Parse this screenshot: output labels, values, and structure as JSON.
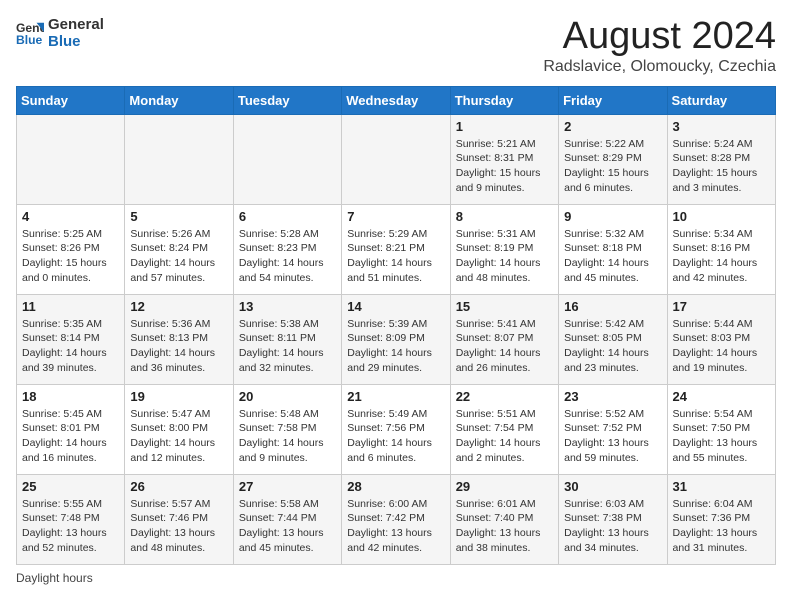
{
  "header": {
    "logo_line1": "General",
    "logo_line2": "Blue",
    "title": "August 2024",
    "subtitle": "Radslavice, Olomoucky, Czechia"
  },
  "days_of_week": [
    "Sunday",
    "Monday",
    "Tuesday",
    "Wednesday",
    "Thursday",
    "Friday",
    "Saturday"
  ],
  "weeks": [
    [
      {
        "num": "",
        "info": ""
      },
      {
        "num": "",
        "info": ""
      },
      {
        "num": "",
        "info": ""
      },
      {
        "num": "",
        "info": ""
      },
      {
        "num": "1",
        "info": "Sunrise: 5:21 AM\nSunset: 8:31 PM\nDaylight: 15 hours\nand 9 minutes."
      },
      {
        "num": "2",
        "info": "Sunrise: 5:22 AM\nSunset: 8:29 PM\nDaylight: 15 hours\nand 6 minutes."
      },
      {
        "num": "3",
        "info": "Sunrise: 5:24 AM\nSunset: 8:28 PM\nDaylight: 15 hours\nand 3 minutes."
      }
    ],
    [
      {
        "num": "4",
        "info": "Sunrise: 5:25 AM\nSunset: 8:26 PM\nDaylight: 15 hours\nand 0 minutes."
      },
      {
        "num": "5",
        "info": "Sunrise: 5:26 AM\nSunset: 8:24 PM\nDaylight: 14 hours\nand 57 minutes."
      },
      {
        "num": "6",
        "info": "Sunrise: 5:28 AM\nSunset: 8:23 PM\nDaylight: 14 hours\nand 54 minutes."
      },
      {
        "num": "7",
        "info": "Sunrise: 5:29 AM\nSunset: 8:21 PM\nDaylight: 14 hours\nand 51 minutes."
      },
      {
        "num": "8",
        "info": "Sunrise: 5:31 AM\nSunset: 8:19 PM\nDaylight: 14 hours\nand 48 minutes."
      },
      {
        "num": "9",
        "info": "Sunrise: 5:32 AM\nSunset: 8:18 PM\nDaylight: 14 hours\nand 45 minutes."
      },
      {
        "num": "10",
        "info": "Sunrise: 5:34 AM\nSunset: 8:16 PM\nDaylight: 14 hours\nand 42 minutes."
      }
    ],
    [
      {
        "num": "11",
        "info": "Sunrise: 5:35 AM\nSunset: 8:14 PM\nDaylight: 14 hours\nand 39 minutes."
      },
      {
        "num": "12",
        "info": "Sunrise: 5:36 AM\nSunset: 8:13 PM\nDaylight: 14 hours\nand 36 minutes."
      },
      {
        "num": "13",
        "info": "Sunrise: 5:38 AM\nSunset: 8:11 PM\nDaylight: 14 hours\nand 32 minutes."
      },
      {
        "num": "14",
        "info": "Sunrise: 5:39 AM\nSunset: 8:09 PM\nDaylight: 14 hours\nand 29 minutes."
      },
      {
        "num": "15",
        "info": "Sunrise: 5:41 AM\nSunset: 8:07 PM\nDaylight: 14 hours\nand 26 minutes."
      },
      {
        "num": "16",
        "info": "Sunrise: 5:42 AM\nSunset: 8:05 PM\nDaylight: 14 hours\nand 23 minutes."
      },
      {
        "num": "17",
        "info": "Sunrise: 5:44 AM\nSunset: 8:03 PM\nDaylight: 14 hours\nand 19 minutes."
      }
    ],
    [
      {
        "num": "18",
        "info": "Sunrise: 5:45 AM\nSunset: 8:01 PM\nDaylight: 14 hours\nand 16 minutes."
      },
      {
        "num": "19",
        "info": "Sunrise: 5:47 AM\nSunset: 8:00 PM\nDaylight: 14 hours\nand 12 minutes."
      },
      {
        "num": "20",
        "info": "Sunrise: 5:48 AM\nSunset: 7:58 PM\nDaylight: 14 hours\nand 9 minutes."
      },
      {
        "num": "21",
        "info": "Sunrise: 5:49 AM\nSunset: 7:56 PM\nDaylight: 14 hours\nand 6 minutes."
      },
      {
        "num": "22",
        "info": "Sunrise: 5:51 AM\nSunset: 7:54 PM\nDaylight: 14 hours\nand 2 minutes."
      },
      {
        "num": "23",
        "info": "Sunrise: 5:52 AM\nSunset: 7:52 PM\nDaylight: 13 hours\nand 59 minutes."
      },
      {
        "num": "24",
        "info": "Sunrise: 5:54 AM\nSunset: 7:50 PM\nDaylight: 13 hours\nand 55 minutes."
      }
    ],
    [
      {
        "num": "25",
        "info": "Sunrise: 5:55 AM\nSunset: 7:48 PM\nDaylight: 13 hours\nand 52 minutes."
      },
      {
        "num": "26",
        "info": "Sunrise: 5:57 AM\nSunset: 7:46 PM\nDaylight: 13 hours\nand 48 minutes."
      },
      {
        "num": "27",
        "info": "Sunrise: 5:58 AM\nSunset: 7:44 PM\nDaylight: 13 hours\nand 45 minutes."
      },
      {
        "num": "28",
        "info": "Sunrise: 6:00 AM\nSunset: 7:42 PM\nDaylight: 13 hours\nand 42 minutes."
      },
      {
        "num": "29",
        "info": "Sunrise: 6:01 AM\nSunset: 7:40 PM\nDaylight: 13 hours\nand 38 minutes."
      },
      {
        "num": "30",
        "info": "Sunrise: 6:03 AM\nSunset: 7:38 PM\nDaylight: 13 hours\nand 34 minutes."
      },
      {
        "num": "31",
        "info": "Sunrise: 6:04 AM\nSunset: 7:36 PM\nDaylight: 13 hours\nand 31 minutes."
      }
    ]
  ],
  "footer": {
    "note": "Daylight hours"
  }
}
